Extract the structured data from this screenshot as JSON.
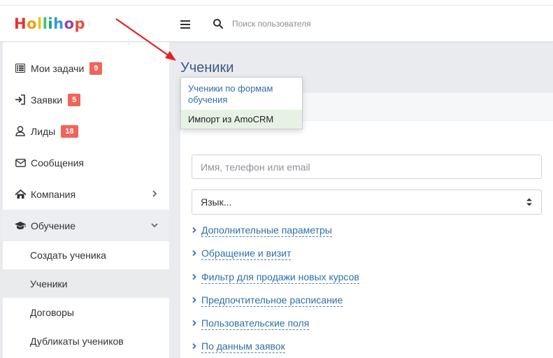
{
  "logo": {
    "letters": [
      "H",
      "o",
      "l",
      "l",
      "i",
      "h",
      "o",
      "p"
    ],
    "colors": [
      "#e8322f",
      "#f39c12",
      "#f1c40f",
      "#2ecc71",
      "#27ae60",
      "#3498db",
      "#9b59b6",
      "#e74c3c"
    ]
  },
  "header": {
    "search_placeholder": "Поиск пользователя"
  },
  "sidebar": {
    "items": [
      {
        "label": "Мои задачи",
        "badge": "9"
      },
      {
        "label": "Заявки",
        "badge": "5"
      },
      {
        "label": "Лиды",
        "badge": "18"
      },
      {
        "label": "Сообщения"
      },
      {
        "label": "Компания"
      },
      {
        "label": "Обучение"
      }
    ],
    "sub_items": [
      {
        "label": "Создать ученика"
      },
      {
        "label": "Ученики"
      },
      {
        "label": "Договоры"
      },
      {
        "label": "Дубликаты учеников"
      }
    ]
  },
  "main": {
    "title": "Ученики",
    "search_placeholder": "Имя, телефон или email",
    "language_select": "Язык...",
    "filters": [
      "Дополнительные параметры",
      "Обращение и визит",
      "Фильтр для продажи новых курсов",
      "Предпочтительное расписание",
      "Пользовательские поля",
      "По данным заявок"
    ]
  },
  "dropdown": {
    "items": [
      "Ученики по формам обучения",
      "Импорт из AmoCRM"
    ]
  },
  "colors": {
    "accent": "#2f6fa8",
    "badge": "#f0645a",
    "annotation": "#e32222"
  }
}
